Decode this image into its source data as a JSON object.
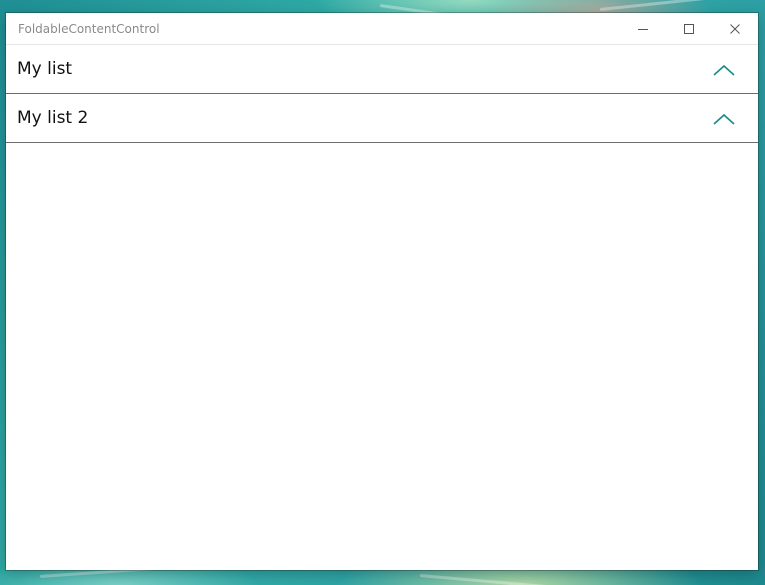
{
  "window": {
    "title": "FoldableContentControl"
  },
  "sections": [
    {
      "title": "My list",
      "expanded": true
    },
    {
      "title": "My list 2",
      "expanded": true
    }
  ],
  "colors": {
    "accent": "#1a8a87",
    "title_text": "#8a8a8a",
    "divider": "#6e6e6e"
  },
  "icons": {
    "minimize": "minimize-icon",
    "maximize": "maximize-icon",
    "close": "close-icon",
    "collapse": "chevron-up-icon"
  }
}
